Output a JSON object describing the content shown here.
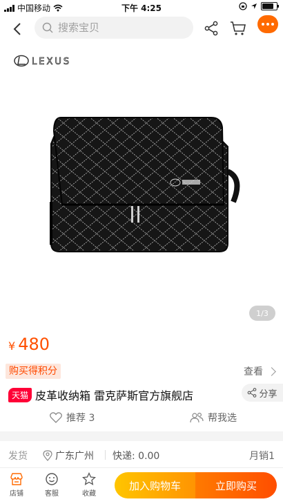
{
  "status_bar": {
    "carrier": "中国移动",
    "time": "下午 4:25",
    "battery_level": 0.85
  },
  "nav": {
    "search_placeholder": "搜索宝贝"
  },
  "image": {
    "brand_text": "LEXUS",
    "page_indicator": "1/3"
  },
  "price": {
    "currency": "¥",
    "amount": "480"
  },
  "points": {
    "tag": "购买得积分",
    "view_label": "查看"
  },
  "product": {
    "badge": "天猫",
    "title": "皮革收纳箱 雷克萨斯官方旗舰店",
    "share_label": "分享"
  },
  "actions": {
    "recommend_label": "推荐 3",
    "help_choose_label": "帮我选"
  },
  "shipping": {
    "label": "发货",
    "location": "广东广州",
    "fee": "快递: 0.00",
    "monthly_sales": "月销1"
  },
  "bottom_bar": {
    "store_label": "店铺",
    "service_label": "客服",
    "favorite_label": "收藏",
    "add_to_cart": "加入购物车",
    "buy_now": "立即购买"
  },
  "colors": {
    "accent": "#ff5000",
    "tmall_red": "#ff0036",
    "cart_yellow": "#ffc500",
    "buy_orange": "#ff4e00"
  }
}
